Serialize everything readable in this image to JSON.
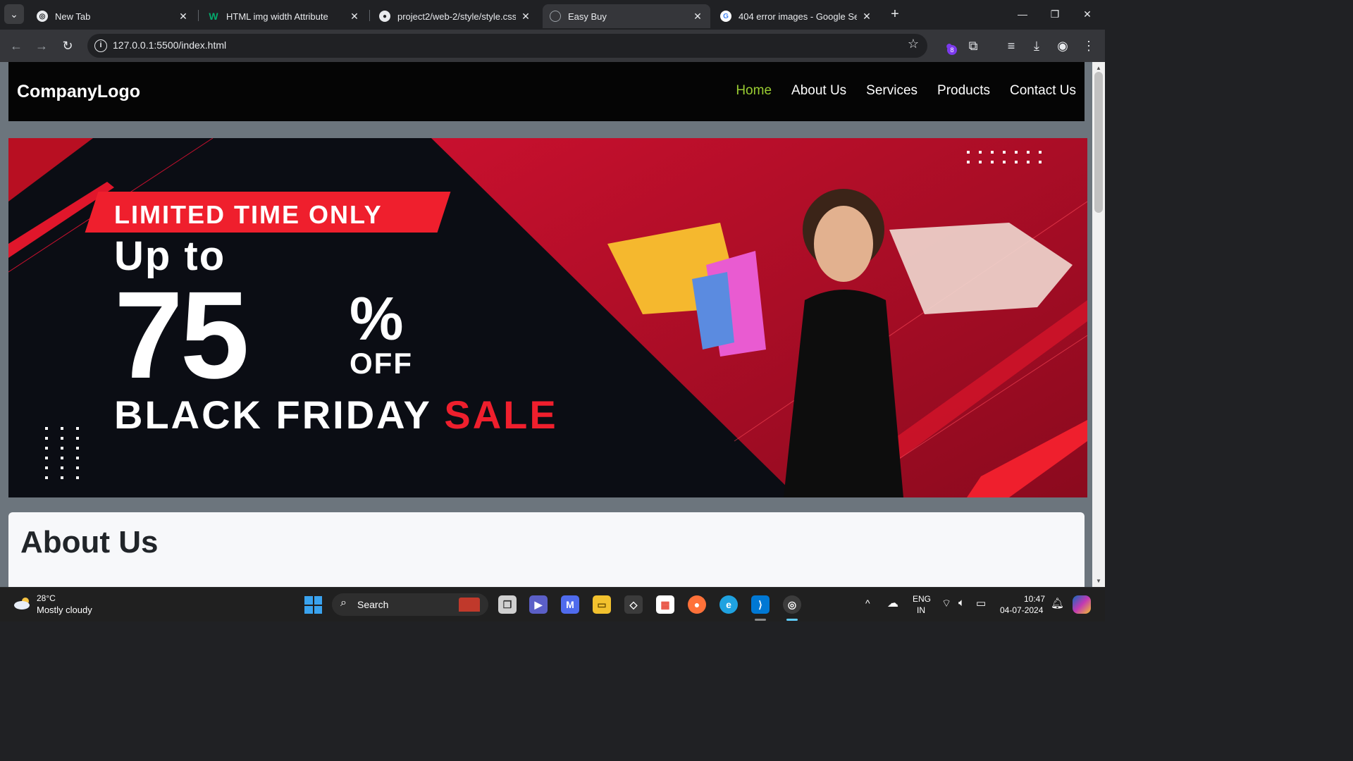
{
  "browser": {
    "tabs": [
      {
        "title": "New Tab",
        "active": false,
        "icon": "chrome-icon"
      },
      {
        "title": "HTML img width Attribute",
        "active": false,
        "icon": "w3schools-icon"
      },
      {
        "title": "project2/web-2/style/style.css a",
        "active": false,
        "icon": "github-icon"
      },
      {
        "title": "Easy Buy",
        "active": true,
        "icon": "globe-icon"
      },
      {
        "title": "404 error images - Google Sear",
        "active": false,
        "icon": "google-icon"
      }
    ],
    "url": "127.0.0.1:5500/index.html",
    "extension_badge": "8"
  },
  "site": {
    "logo": "CompanyLogo",
    "nav": [
      "Home",
      "About Us",
      "Services",
      "Products",
      "Contact Us"
    ],
    "active_nav": "Home",
    "banner": {
      "ribbon": "LIMITED TIME ONLY",
      "up_to": "Up to",
      "discount": "75",
      "percent": "%",
      "off": "OFF",
      "headline": "BLACK FRIDAY",
      "sale": "SALE"
    },
    "about_title": "About Us"
  },
  "taskbar": {
    "weather_temp": "28°C",
    "weather_desc": "Mostly cloudy",
    "search_label": "Search",
    "lang_top": "ENG",
    "lang_bottom": "IN",
    "time": "10:47",
    "date": "04-07-2024"
  },
  "colors": {
    "accent_nav": "#9acd32",
    "banner_red": "#ef1f2d",
    "page_bg": "#6c757d"
  }
}
